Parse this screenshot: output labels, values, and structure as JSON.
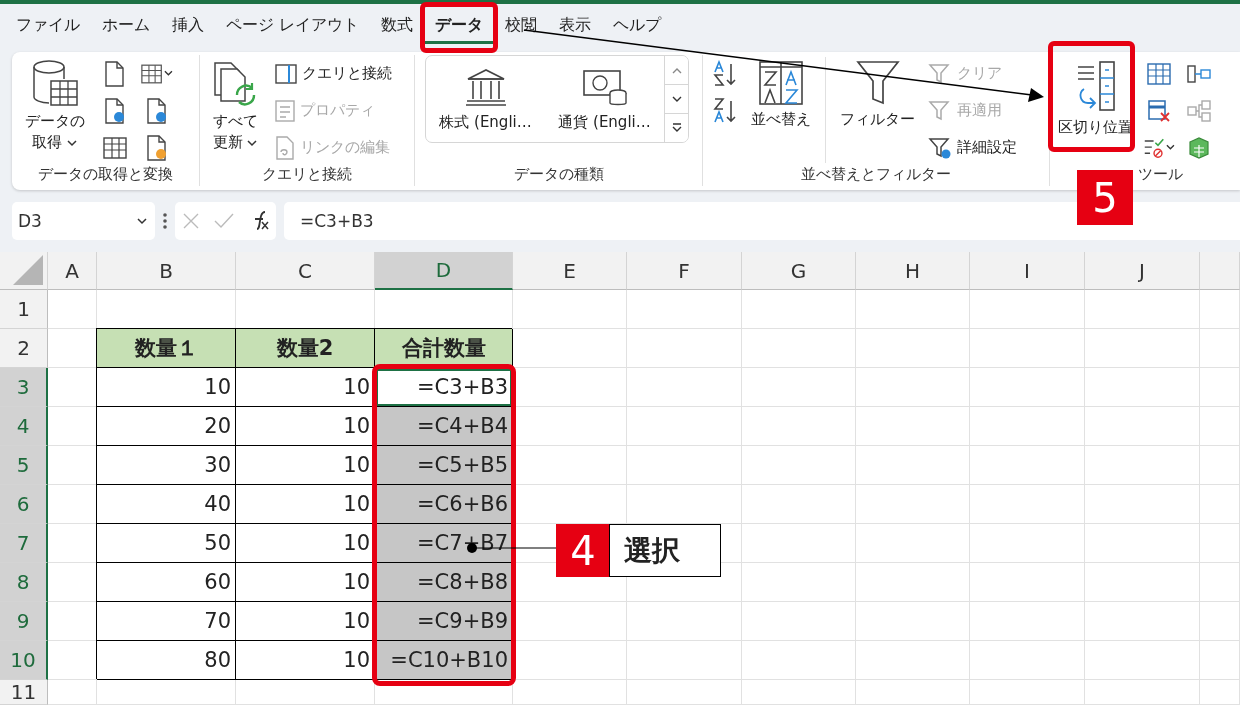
{
  "menu_tabs": [
    {
      "label": "ファイル",
      "selected": false
    },
    {
      "label": "ホーム",
      "selected": false
    },
    {
      "label": "挿入",
      "selected": false
    },
    {
      "label": "ページ レイアウト",
      "selected": false
    },
    {
      "label": "数式",
      "selected": false
    },
    {
      "label": "データ",
      "selected": true
    },
    {
      "label": "校閲",
      "selected": false
    },
    {
      "label": "表示",
      "selected": false
    },
    {
      "label": "ヘルプ",
      "selected": false
    }
  ],
  "ribbon": {
    "groups": [
      {
        "kind": "get-data",
        "label": "データの取得と変換",
        "items": [
          {
            "label": "データの取得"
          }
        ]
      },
      {
        "kind": "queries",
        "label": "クエリと接続",
        "items": [
          {
            "label": "すべて更新"
          },
          {
            "label": "クエリと接続",
            "disabled": false
          },
          {
            "label": "プロパティ",
            "disabled": true
          },
          {
            "label": "リンクの編集",
            "disabled": true
          }
        ]
      },
      {
        "kind": "data-types",
        "label": "データの種類",
        "items": [
          {
            "label": "株式 (Engli…"
          },
          {
            "label": "通貨 (Engli…"
          }
        ]
      },
      {
        "kind": "sort-filter",
        "label": "並べ替えとフィルター",
        "items": [
          {
            "label": "並べ替え"
          },
          {
            "label": "フィルター"
          },
          {
            "label": "クリア",
            "disabled": true
          },
          {
            "label": "再適用",
            "disabled": true
          },
          {
            "label": "詳細設定",
            "disabled": false
          }
        ]
      },
      {
        "kind": "data-tools",
        "label": "ツール",
        "items": [
          {
            "label": "区切り位置"
          }
        ]
      }
    ]
  },
  "formula_bar": {
    "name_box": "D3",
    "formula": "=C3+B3"
  },
  "sheet": {
    "columns": [
      {
        "label": "A",
        "selected": false
      },
      {
        "label": "B",
        "selected": false
      },
      {
        "label": "C",
        "selected": false
      },
      {
        "label": "D",
        "selected": true
      },
      {
        "label": "E",
        "selected": false
      },
      {
        "label": "F",
        "selected": false
      },
      {
        "label": "G",
        "selected": false
      },
      {
        "label": "H",
        "selected": false
      },
      {
        "label": "I",
        "selected": false
      },
      {
        "label": "J",
        "selected": false
      }
    ],
    "rows": [
      {
        "number": "1",
        "selected": false
      },
      {
        "number": "2",
        "selected": false,
        "cells": [
          {
            "kind": "header",
            "text": "数量１"
          },
          {
            "kind": "header",
            "text": "数量2"
          },
          {
            "kind": "header",
            "text": "合計数量"
          }
        ]
      },
      {
        "number": "3",
        "selected": true,
        "cells": [
          {
            "kind": "value",
            "text": "10",
            "selected": false
          },
          {
            "kind": "value",
            "text": "10",
            "selected": false
          },
          {
            "kind": "value",
            "text": "=C3+B3",
            "selected": true,
            "active": true
          }
        ]
      },
      {
        "number": "4",
        "selected": true,
        "cells": [
          {
            "kind": "value",
            "text": "20",
            "selected": false
          },
          {
            "kind": "value",
            "text": "10",
            "selected": false
          },
          {
            "kind": "value",
            "text": "=C4+B4",
            "selected": true
          }
        ]
      },
      {
        "number": "5",
        "selected": true,
        "cells": [
          {
            "kind": "value",
            "text": "30",
            "selected": false
          },
          {
            "kind": "value",
            "text": "10",
            "selected": false
          },
          {
            "kind": "value",
            "text": "=C5+B5",
            "selected": true
          }
        ]
      },
      {
        "number": "6",
        "selected": true,
        "cells": [
          {
            "kind": "value",
            "text": "40",
            "selected": false
          },
          {
            "kind": "value",
            "text": "10",
            "selected": false
          },
          {
            "kind": "value",
            "text": "=C6+B6",
            "selected": true
          }
        ]
      },
      {
        "number": "7",
        "selected": true,
        "cells": [
          {
            "kind": "value",
            "text": "50",
            "selected": false
          },
          {
            "kind": "value",
            "text": "10",
            "selected": false
          },
          {
            "kind": "value",
            "text": "=C7+B7",
            "selected": true
          }
        ]
      },
      {
        "number": "8",
        "selected": true,
        "cells": [
          {
            "kind": "value",
            "text": "60",
            "selected": false
          },
          {
            "kind": "value",
            "text": "10",
            "selected": false
          },
          {
            "kind": "value",
            "text": "=C8+B8",
            "selected": true
          }
        ]
      },
      {
        "number": "9",
        "selected": true,
        "cells": [
          {
            "kind": "value",
            "text": "70",
            "selected": false
          },
          {
            "kind": "value",
            "text": "10",
            "selected": false
          },
          {
            "kind": "value",
            "text": "=C9+B9",
            "selected": true
          }
        ]
      },
      {
        "number": "10",
        "selected": true,
        "cells": [
          {
            "kind": "value",
            "text": "80",
            "selected": false
          },
          {
            "kind": "value",
            "text": "10",
            "selected": false
          },
          {
            "kind": "value",
            "text": "=C10+B10",
            "selected": true
          }
        ]
      },
      {
        "number": "11",
        "selected": false
      }
    ]
  },
  "callouts": [
    {
      "number": "4",
      "label": "選択"
    },
    {
      "number": "5"
    }
  ]
}
